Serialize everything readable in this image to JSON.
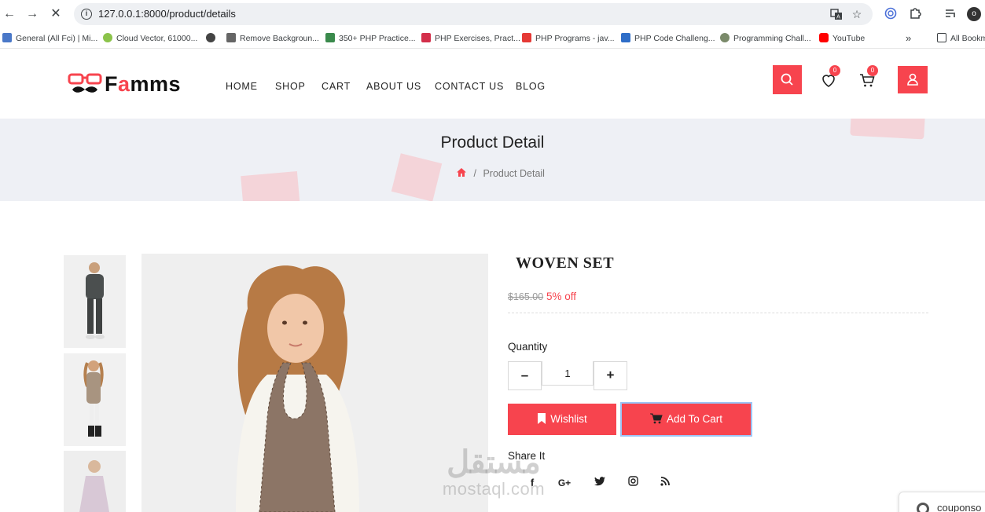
{
  "browser": {
    "url": "127.0.0.1:8000/product/details",
    "bookmarks": [
      "General (All Fci) | Mi...",
      "Cloud Vector, 61000...",
      "Remove Backgroun...",
      "350+ PHP Practice...",
      "PHP Exercises, Pract...",
      "PHP Programs - jav...",
      "PHP Code Challeng...",
      "Programming Chall...",
      "YouTube"
    ],
    "bookmarks_overflow": "»",
    "all_bookmarks": "All Bookm",
    "profile_initial": "o"
  },
  "site": {
    "logo_prefix": "F",
    "logo_accent": "a",
    "logo_suffix": "mms",
    "nav": [
      "HOME",
      "SHOP",
      "CART",
      "ABOUT US",
      "CONTACT US",
      "BLOG"
    ],
    "wishlist_count": "0",
    "cart_count": "0",
    "accent_color": "#f7444e"
  },
  "hero": {
    "title": "Product Detail",
    "breadcrumb_separator": "/",
    "breadcrumb_current": "Product Detail"
  },
  "product": {
    "name": "WOVEN SET",
    "old_price": "$165.00",
    "discount": "5% off",
    "quantity_label": "Quantity",
    "quantity_value": "1",
    "minus": "–",
    "plus": "+",
    "wishlist_label": "Wishlist",
    "add_to_cart_label": "Add To Cart",
    "share_label": "Share It",
    "social_icons": [
      "facebook-icon",
      "google-plus-icon",
      "twitter-icon",
      "instagram-icon",
      "rss-icon"
    ]
  },
  "watermark": {
    "arabic": "مستقل",
    "latin": "mostaql.com"
  },
  "toast": {
    "text": "couponso"
  }
}
